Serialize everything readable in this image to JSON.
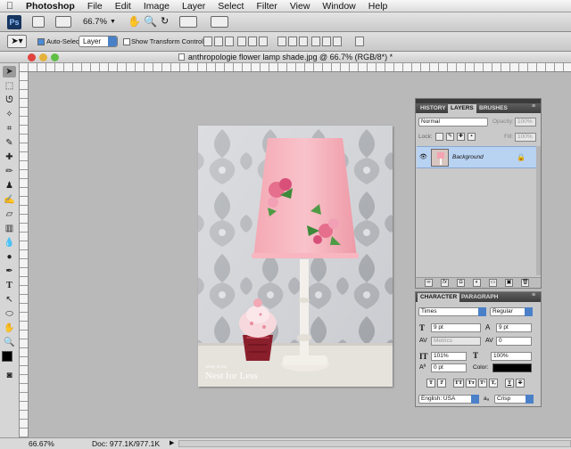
{
  "menu": {
    "apple_icon": "apple-icon",
    "items": [
      "Photoshop",
      "File",
      "Edit",
      "Image",
      "Layer",
      "Select",
      "Filter",
      "View",
      "Window",
      "Help"
    ]
  },
  "appbar": {
    "ps_label": "Ps",
    "zoom": "66.7%"
  },
  "options": {
    "auto_select_label": "Auto-Select:",
    "auto_select_checked": true,
    "auto_select_value": "Layer",
    "show_transform_label": "Show Transform Controls",
    "show_transform_checked": false
  },
  "document": {
    "title": "anthropologie flower lamp shade.jpg @ 66.7% (RGB/8*) *",
    "watermark": "Nest for Less",
    "watermark_small": "Jenny at the"
  },
  "layers_panel": {
    "tabs": [
      "HISTORY",
      "LAYERS",
      "BRUSHES"
    ],
    "active_tab": "LAYERS",
    "blend_mode": "Normal",
    "opacity_label": "Opacity:",
    "opacity_value": "100%",
    "lock_label": "Lock:",
    "fill_label": "Fill:",
    "fill_value": "100%",
    "layer_name": "Background"
  },
  "character_panel": {
    "tabs": [
      "CHARACTER",
      "PARAGRAPH"
    ],
    "active_tab": "CHARACTER",
    "font_family": "Times",
    "font_style": "Regular",
    "font_size": "9 pt",
    "leading": "9 pt",
    "kerning": "Metrics",
    "tracking": "0",
    "vertical_scale": "101%",
    "horizontal_scale": "100%",
    "baseline_shift": "0 pt",
    "color_label": "Color:",
    "text_buttons": [
      "T",
      "T",
      "TT",
      "Tт",
      "T¹",
      "T,",
      "T",
      "T"
    ],
    "language": "English: USA",
    "aa_label": "aₐ",
    "antialias": "Crisp"
  },
  "status": {
    "zoom": "66.67%",
    "doc": "Doc: 977.1K/977.1K"
  },
  "colors": {
    "accent": "#4a80c8",
    "layer_selected": "#b8d2f2"
  }
}
